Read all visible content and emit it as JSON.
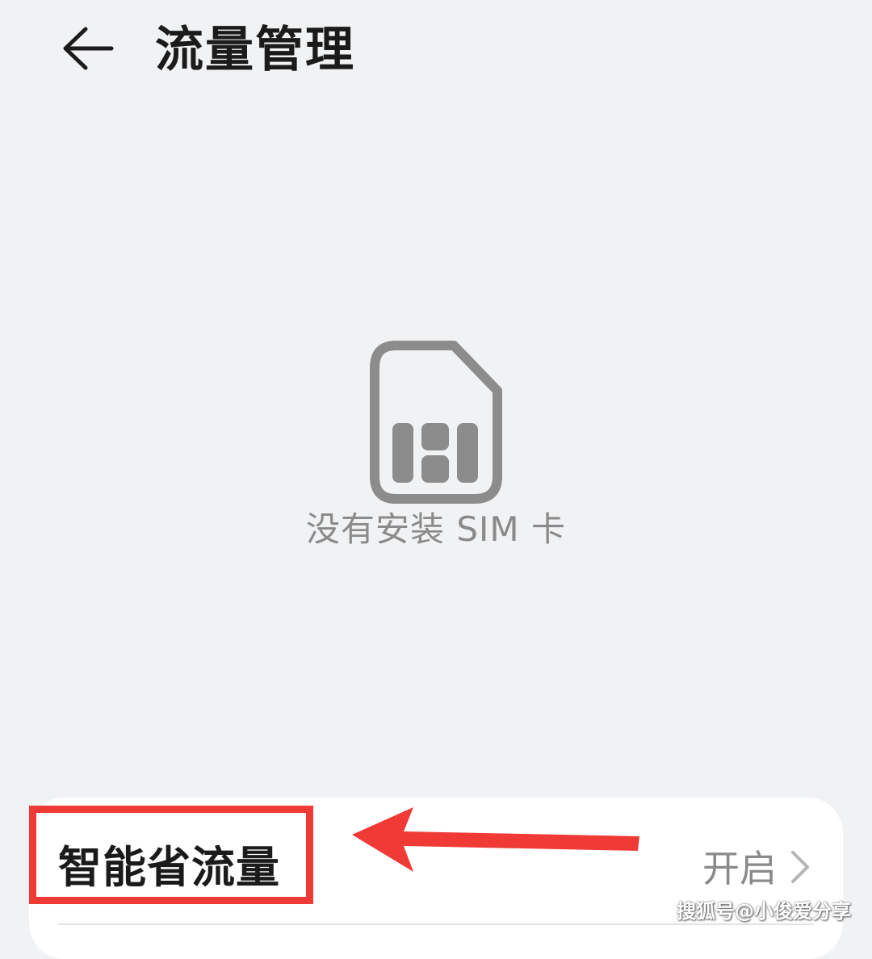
{
  "header": {
    "title": "流量管理",
    "back_icon": "arrow-left-icon"
  },
  "empty_state": {
    "icon": "sim-card-icon",
    "message": "没有安装 SIM 卡",
    "icon_color": "#8c8c8c"
  },
  "settings": {
    "items": [
      {
        "label": "智能省流量",
        "value": "开启",
        "icon": "chevron-right-icon"
      }
    ]
  },
  "annotation": {
    "color": "#f03a35",
    "icon": "red-arrow-left-icon"
  },
  "watermark": {
    "text": "搜狐号@小俊爱分享"
  },
  "colors": {
    "background": "#f1f2f4",
    "card": "#ffffff",
    "primary_text": "#1b1b1b",
    "secondary_text": "#8a8a8a"
  }
}
